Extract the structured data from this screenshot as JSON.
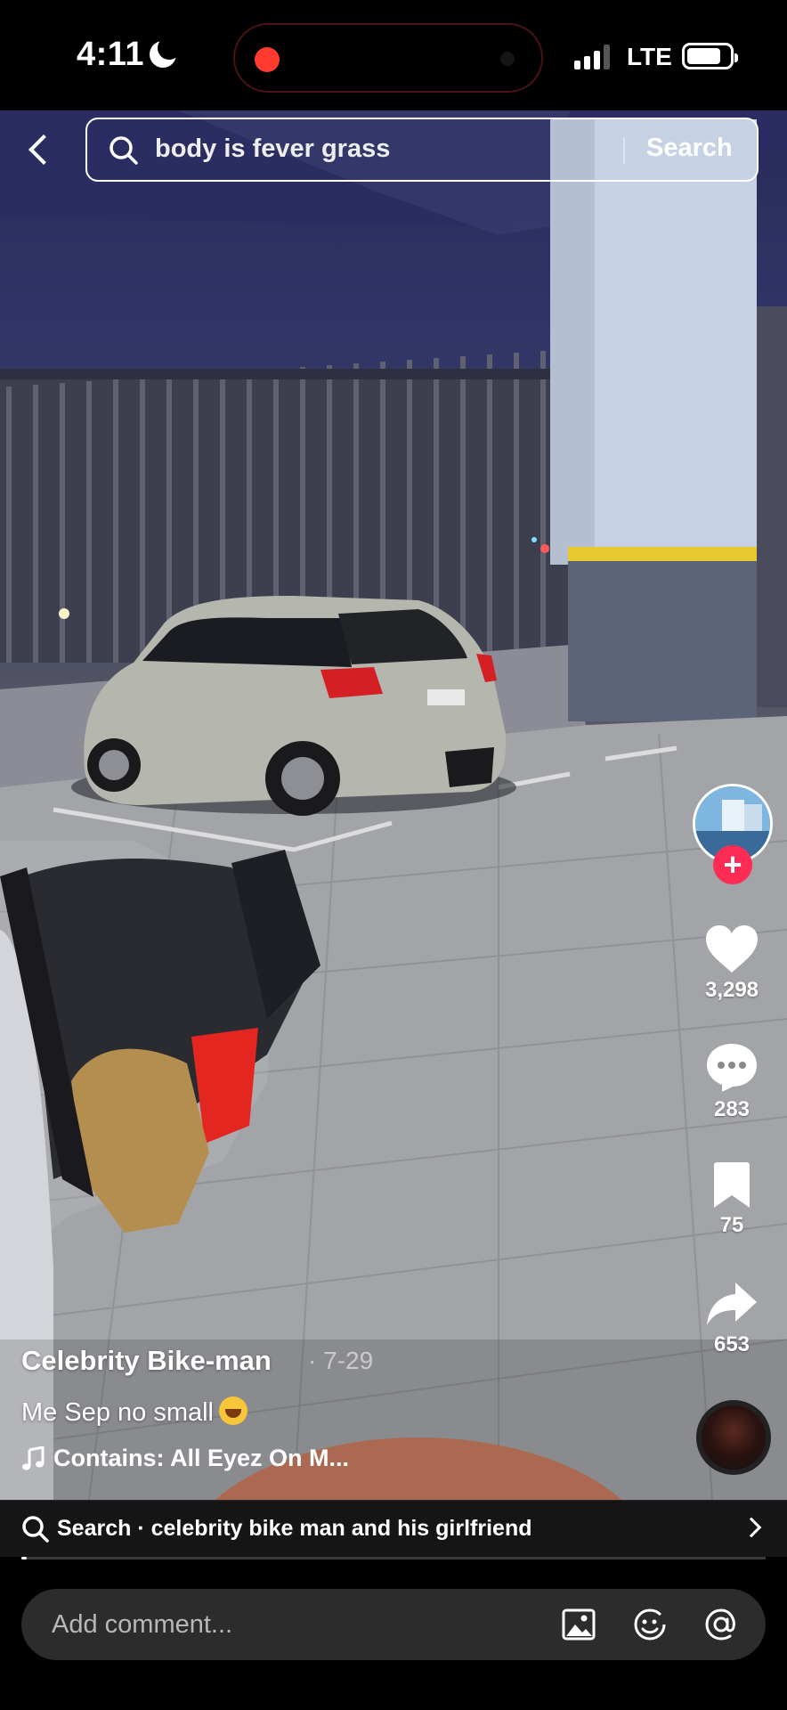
{
  "status_bar": {
    "time": "4:11",
    "network": "LTE",
    "icons": [
      "moon-icon",
      "record-indicator",
      "signal-icon",
      "battery-icon"
    ]
  },
  "search": {
    "query": "body is fever grass",
    "button_label": "Search",
    "icons": [
      "back-chevron-icon",
      "search-icon"
    ]
  },
  "actions": {
    "likes": "3,298",
    "comments": "283",
    "saves": "75",
    "shares": "653",
    "icons": [
      "heart-icon",
      "comment-icon",
      "bookmark-icon",
      "share-icon",
      "plus-icon"
    ],
    "follow_symbol": "+"
  },
  "post": {
    "author": "Celebrity Bike-man",
    "date": "· 7-29",
    "caption": "Me Sep no small",
    "caption_emoji": "laughing-tears-emoji",
    "music": "Contains: All Eyez On M..."
  },
  "suggestion": {
    "text": "Search · celebrity bike man and his girlfriend",
    "icons": [
      "search-icon",
      "chevron-right-icon"
    ]
  },
  "video": {
    "progress_fraction": 0.006
  },
  "comment_bar": {
    "placeholder": "Add comment...",
    "icons": [
      "image-icon",
      "emoji-icon",
      "mention-icon"
    ]
  },
  "colors": {
    "accent_follow": "#fe2c55",
    "record_dot": "#ff3b30",
    "pillar_stripe": "#e8c830",
    "background": "#000000"
  }
}
